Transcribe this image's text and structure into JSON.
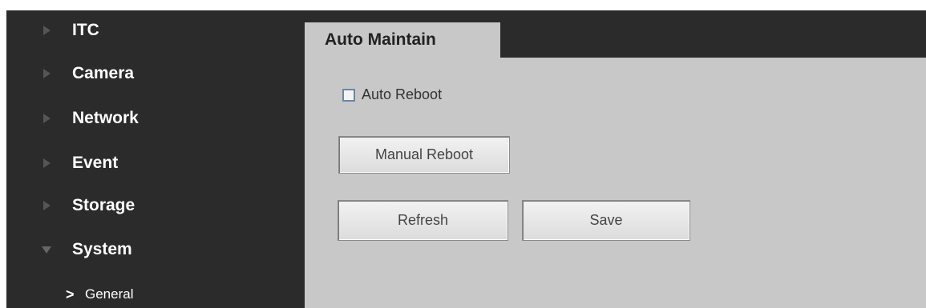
{
  "sidebar": {
    "items": [
      {
        "label": "ITC",
        "icon": "triangle-right-icon"
      },
      {
        "label": "Camera",
        "icon": "triangle-right-icon"
      },
      {
        "label": "Network",
        "icon": "triangle-right-icon"
      },
      {
        "label": "Event",
        "icon": "triangle-right-icon"
      },
      {
        "label": "Storage",
        "icon": "triangle-right-icon"
      },
      {
        "label": "System",
        "icon": "triangle-down-icon"
      }
    ],
    "subitems": [
      {
        "label": "General",
        "icon": "chevron-right-icon",
        "chevron": ">"
      }
    ]
  },
  "tabs": [
    {
      "label": "Auto Maintain"
    }
  ],
  "form": {
    "auto_reboot_label": "Auto Reboot",
    "auto_reboot_checked": false,
    "manual_reboot_label": "Manual Reboot",
    "refresh_label": "Refresh",
    "save_label": "Save"
  },
  "colors": {
    "sidebar_bg": "#2b2b2b",
    "content_bg": "#c8c8c8"
  }
}
